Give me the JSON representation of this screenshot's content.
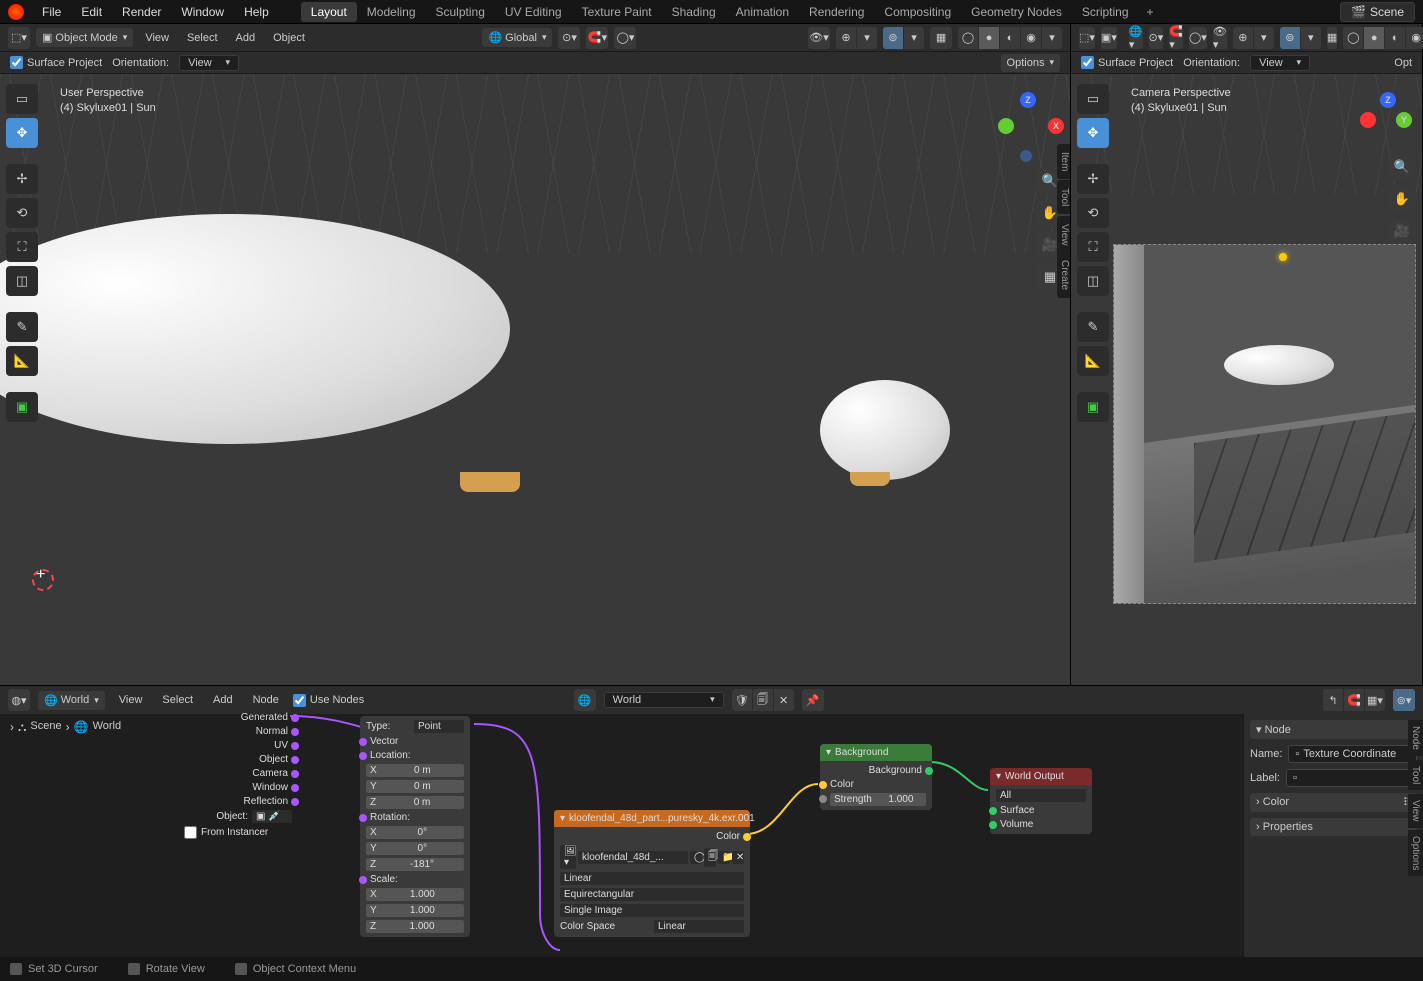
{
  "topbar": {
    "menus": [
      "File",
      "Edit",
      "Render",
      "Window",
      "Help"
    ],
    "tabs": [
      "Layout",
      "Modeling",
      "Sculpting",
      "UV Editing",
      "Texture Paint",
      "Shading",
      "Animation",
      "Rendering",
      "Compositing",
      "Geometry Nodes",
      "Scripting"
    ],
    "active_tab": 0,
    "scene_label": "Scene"
  },
  "viewportL": {
    "mode": "Object Mode",
    "hdr_menus": [
      "View",
      "Select",
      "Add",
      "Object"
    ],
    "global": "Global",
    "surface_cb": "Surface Project",
    "orientation_lbl": "Orientation:",
    "orientation_val": "View",
    "options_btn": "Options",
    "persp_title": "User Perspective",
    "persp_sub": "(4) Skyluxe01 | Sun"
  },
  "viewportR": {
    "surface_cb": "Surface Project",
    "orientation_lbl": "Orientation:",
    "orientation_val": "View",
    "opt": "Opt",
    "persp_title": "Camera Perspective",
    "persp_sub": "(4) Skyluxe01 | Sun"
  },
  "vtabs": {
    "item": "Item",
    "tool": "Tool",
    "view": "View",
    "create": "Create"
  },
  "nodeEditor": {
    "editor_sel": "World",
    "hdr_menus": [
      "View",
      "Select",
      "Add",
      "Node"
    ],
    "use_nodes": "Use Nodes",
    "world_sel": "World",
    "bc_scene": "Scene",
    "bc_world": "World",
    "object_lbl": "Object:",
    "from_inst": "From Instancer",
    "texcoord_outputs": [
      "Generated",
      "Normal",
      "UV",
      "Object",
      "Camera",
      "Window",
      "Reflection"
    ],
    "mapping": {
      "type_lbl": "Type:",
      "type_val": "Point",
      "vector": "Vector",
      "location": "Location:",
      "loc_vals": [
        "0 m",
        "0 m",
        "0 m"
      ],
      "rotation": "Rotation:",
      "rot_vals": [
        "0°",
        "0°",
        "-181°"
      ],
      "scale": "Scale:",
      "scale_vals": [
        "1.000",
        "1.000",
        "1.000"
      ],
      "axes": [
        "X",
        "Y",
        "Z"
      ]
    },
    "envtex": {
      "title": "kloofendal_48d_part...puresky_4k.exr.001",
      "color": "Color",
      "img": "kloofendal_48d_...",
      "sel1": "Linear",
      "sel2": "Equirectangular",
      "sel3": "Single Image",
      "cs_lbl": "Color Space",
      "cs_val": "Linear"
    },
    "bg": {
      "title": "Background",
      "out": "Background",
      "color": "Color",
      "str_lbl": "Strength",
      "str_val": "1.000"
    },
    "wout": {
      "title": "World Output",
      "all": "All",
      "surface": "Surface",
      "volume": "Volume"
    }
  },
  "nPanel": {
    "node": "Node",
    "name_lbl": "Name:",
    "name_val": "Texture Coordinate",
    "label_lbl": "Label:",
    "label_val": "",
    "color": "Color",
    "properties": "Properties"
  },
  "nPanel_tabs": [
    "Node",
    "Tool",
    "View",
    "Options"
  ],
  "status": {
    "s1": "Set 3D Cursor",
    "s2": "Rotate View",
    "s3": "Object Context Menu"
  }
}
